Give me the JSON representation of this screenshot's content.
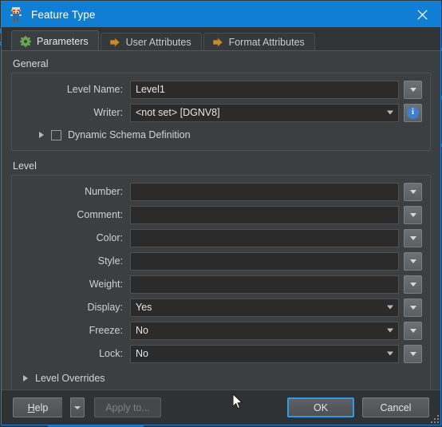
{
  "window": {
    "title": "Feature Type",
    "icon": "feature-type-icon",
    "close_label": "×",
    "accent_color": "#0f7ed3",
    "border_color": "#1f7fd4"
  },
  "tabs": [
    {
      "label": "Parameters",
      "icon": "gear-icon",
      "icon_color": "#6aa84f",
      "active": true
    },
    {
      "label": "User Attributes",
      "icon": "arrow-right-icon",
      "icon_color": "#c98a2b",
      "active": false
    },
    {
      "label": "Format Attributes",
      "icon": "arrow-right-icon",
      "icon_color": "#c98a2b",
      "active": false
    }
  ],
  "general": {
    "group_label": "General",
    "fields": [
      {
        "label": "Level Name:",
        "value": "Level1",
        "type": "text",
        "side_button": "dropdown-button"
      },
      {
        "label": "Writer:",
        "value": "<not set> [DGNV8]",
        "type": "combo",
        "side_button": "info-button"
      }
    ],
    "dynamic_schema": {
      "label": "Dynamic Schema Definition",
      "checked": false,
      "expanded": false
    }
  },
  "level": {
    "group_label": "Level",
    "fields": [
      {
        "label": "Number:",
        "value": "",
        "type": "text",
        "side_button": "dropdown-button"
      },
      {
        "label": "Comment:",
        "value": "",
        "type": "text",
        "side_button": "dropdown-button"
      },
      {
        "label": "Color:",
        "value": "",
        "type": "text",
        "side_button": "dropdown-button"
      },
      {
        "label": "Style:",
        "value": "",
        "type": "text",
        "side_button": "dropdown-button"
      },
      {
        "label": "Weight:",
        "value": "",
        "type": "text",
        "side_button": "dropdown-button"
      },
      {
        "label": "Display:",
        "value": "Yes",
        "type": "combo",
        "side_button": "dropdown-button"
      },
      {
        "label": "Freeze:",
        "value": "No",
        "type": "combo",
        "side_button": "dropdown-button"
      },
      {
        "label": "Lock:",
        "value": "No",
        "type": "combo",
        "side_button": "dropdown-button"
      }
    ],
    "overrides": {
      "label": "Level Overrides",
      "expanded": false
    }
  },
  "buttons": {
    "help": "Help",
    "help_mnemonic": "H",
    "help_rest": "elp",
    "apply_to": "Apply to...",
    "apply_to_enabled": false,
    "ok": "OK",
    "ok_focused": true,
    "cancel": "Cancel"
  }
}
